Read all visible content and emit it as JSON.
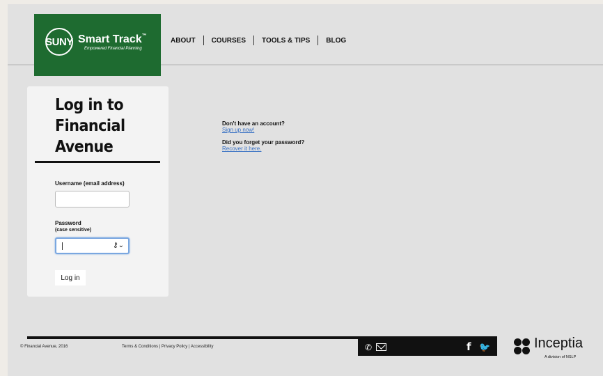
{
  "brand": {
    "logo_mark": "SUNY",
    "logo_title": "Smart Track",
    "logo_tm": "™",
    "tagline": "Empowered Financial Planning"
  },
  "nav": {
    "items": [
      {
        "label": "ABOUT"
      },
      {
        "label": "COURSES"
      },
      {
        "label": "TOOLS & TIPS"
      },
      {
        "label": "BLOG"
      }
    ]
  },
  "login": {
    "title": "Log in to Financial Avenue",
    "username_label": "Username (email address)",
    "username_value": "",
    "password_label": "Password",
    "password_sub": "(case sensitive)",
    "password_value": "",
    "button_label": "Log in"
  },
  "helpers": {
    "signup_question": "Don't have an account?",
    "signup_link": "Sign up now!",
    "forgot_question": "Did you forget your password?",
    "forgot_link": "Recover it here."
  },
  "footer": {
    "copyright": "© Financial Avenue, 2016",
    "links": "Terms & Conditions | Privacy Policy | Accessibility",
    "partner_name": "Inceptia",
    "partner_sub": "A division of NSLP"
  },
  "icons": {
    "phone": "phone-icon",
    "mail": "mail-icon",
    "facebook": "facebook-icon",
    "twitter": "twitter-icon",
    "password_manager": "key-icon"
  },
  "colors": {
    "brand_green": "#1e6b30",
    "link_blue": "#3a72c4",
    "focus_blue": "#7aa7e0"
  }
}
